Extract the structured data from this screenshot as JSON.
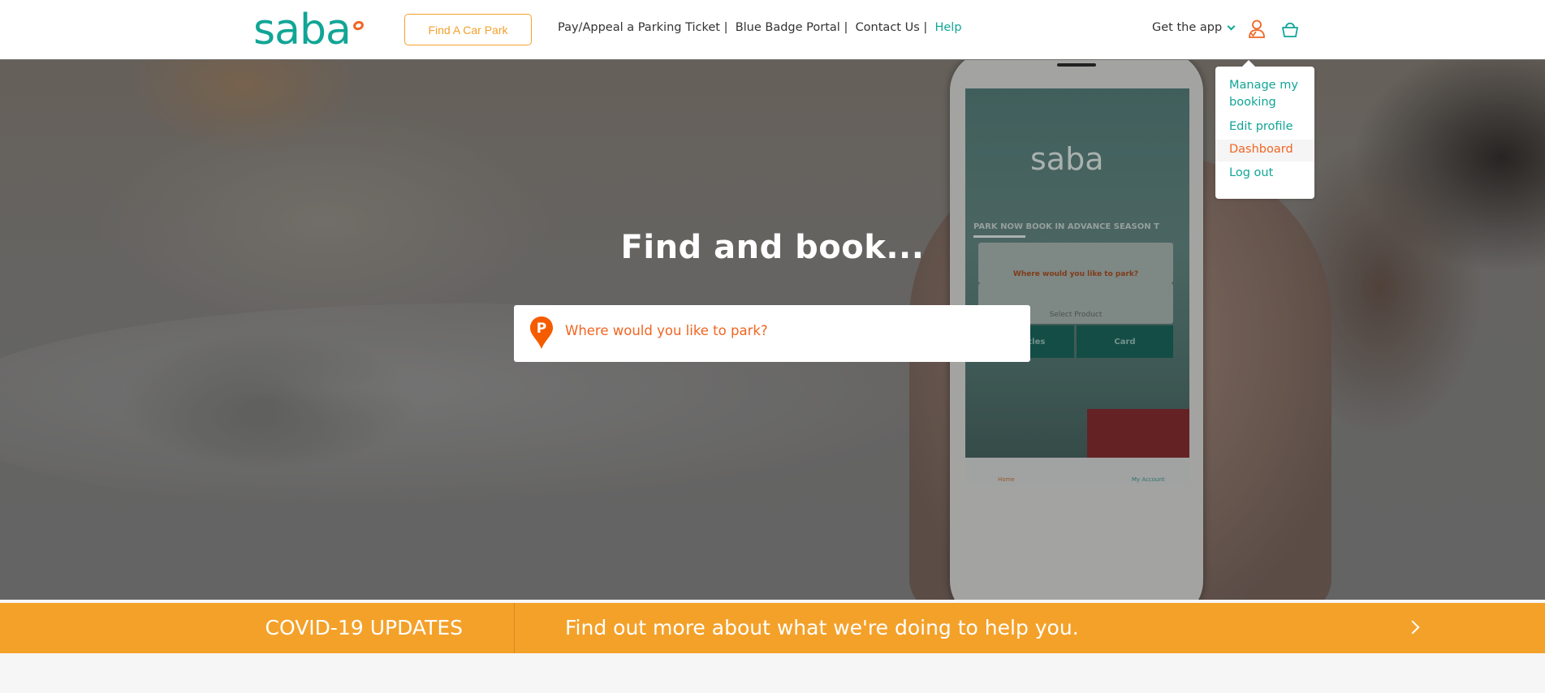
{
  "header": {
    "logo_text": "saba",
    "find_car_park": "Find A Car Park",
    "nav": [
      {
        "label": "Pay/Appeal a Parking Ticket"
      },
      {
        "label": "Blue Badge Portal"
      },
      {
        "label": "Contact Us"
      },
      {
        "label": "Help"
      }
    ],
    "separator": " |  ",
    "get_app": "Get the app",
    "icons": {
      "user": "user-icon",
      "basket": "basket-icon",
      "chevron": "chevron-down-icon"
    }
  },
  "account_menu": {
    "items": [
      {
        "label": "Manage my booking"
      },
      {
        "label": "Edit profile"
      },
      {
        "label": "Dashboard",
        "highlighted": true
      },
      {
        "label": "Log out"
      }
    ]
  },
  "hero": {
    "title": "Find and book...",
    "search_placeholder": "Where would you like to park?",
    "search_value": "",
    "pin_letter": "P",
    "phone": {
      "logo": "saba",
      "tabs": "PARK NOW  BOOK IN ADVANCE  SEASON T",
      "search_card": "Where would you like to park?",
      "product_card": "Select Product",
      "vehicles_button": "Vehicles",
      "card_button": "Card",
      "bar": [
        "Home",
        "My Account"
      ]
    }
  },
  "covid_banner": {
    "title": "COVID-19 UPDATES",
    "message": "Find out more about what we're doing to help you."
  },
  "colors": {
    "brand_teal": "#11a596",
    "brand_orange": "#f06522",
    "accent_amber": "#f4a12a"
  }
}
